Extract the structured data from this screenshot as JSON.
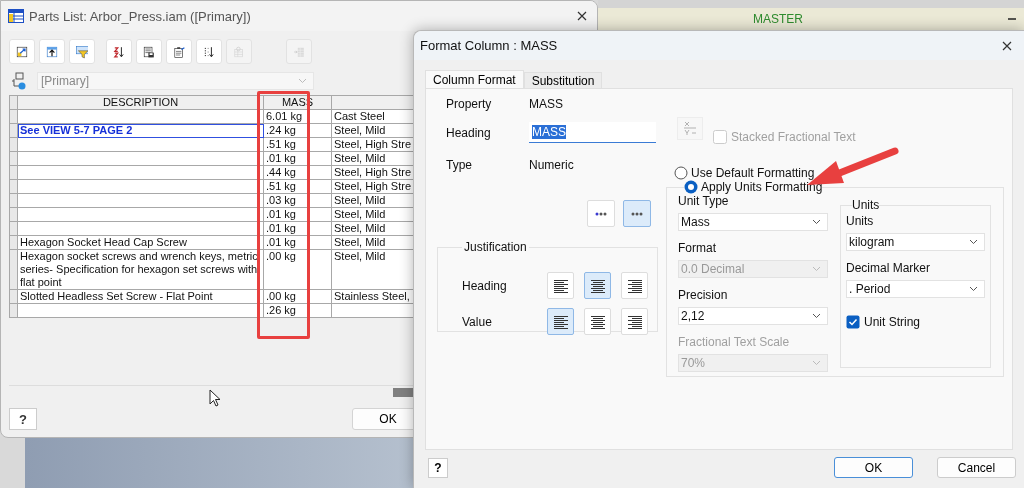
{
  "background_window": {
    "title": "MASTER"
  },
  "parts_list": {
    "title": "Parts List: Arbor_Press.iam ([Primary])",
    "toolbar_groups": [
      {
        "buttons": [
          {
            "disabled": false
          },
          {
            "disabled": false
          },
          {
            "disabled": false
          }
        ]
      },
      {
        "buttons": [
          {
            "disabled": false
          },
          {
            "disabled": false
          },
          {
            "disabled": false
          },
          {
            "disabled": false
          },
          {
            "disabled": true
          }
        ]
      },
      {
        "buttons": [
          {
            "disabled": true
          }
        ]
      }
    ],
    "view": {
      "value": "[Primary]",
      "disabled": true
    },
    "table": {
      "columns": [
        "DESCRIPTION",
        "MASS"
      ],
      "rows": [
        {
          "mass": "6.01 kg",
          "column_3": "Cast Steel",
          "selected": false
        },
        {
          "description": "See VIEW 5-7 PAGE 2",
          "mass": ".24 kg",
          "column_3": "Steel, Mild",
          "selected": true
        },
        {
          "mass": ".51 kg",
          "column_3": "Steel, High Stre",
          "selected": false
        },
        {
          "mass": ".01 kg",
          "column_3": "Steel, Mild",
          "selected": false
        },
        {
          "mass": ".44 kg",
          "column_3": "Steel, High Stre",
          "selected": false
        },
        {
          "mass": ".51 kg",
          "column_3": "Steel, High Stre",
          "selected": false
        },
        {
          "mass": ".03 kg",
          "column_3": "Steel, Mild",
          "selected": false
        },
        {
          "mass": ".01 kg",
          "column_3": "Steel, Mild",
          "selected": false
        },
        {
          "mass": ".01 kg",
          "column_3": "Steel, Mild",
          "selected": false
        },
        {
          "description": "Hexagon Socket Head Cap Screw",
          "mass": ".01 kg",
          "column_3": "Steel, Mild",
          "selected": false
        },
        {
          "description": "Hexagon socket screws and wrench keys, metric series- Specification for hexagon set screws with flat point",
          "mass": ".00 kg",
          "column_3": "Steel, Mild",
          "selected": false
        },
        {
          "description": "Slotted Headless Set Screw - Flat Point",
          "mass": ".00 kg",
          "column_3": "Stainless Steel,",
          "selected": false
        },
        {
          "mass": ".26 kg",
          "selected": false
        }
      ]
    },
    "help_button": "?",
    "ok_button": "OK"
  },
  "format_dialog": {
    "title": "Format Column : MASS",
    "tabs": [
      {
        "label": "Column Format",
        "selected": true
      },
      {
        "label": "Substitution",
        "selected": false
      }
    ],
    "fields": [
      {
        "kind": "text",
        "label": "Property",
        "value": "MASS"
      },
      {
        "kind": "input",
        "label": "Heading",
        "value": "MASS",
        "text_selected": true
      },
      {
        "kind": "text",
        "label": "Type",
        "value": "Numeric"
      }
    ],
    "position_buttons": [
      {
        "selected": false
      },
      {
        "selected": true
      }
    ],
    "justification": {
      "title": "Justification",
      "rows": [
        {
          "label": "Heading",
          "options": [
            {
              "selected": false
            },
            {
              "selected": true
            },
            {
              "selected": false
            }
          ]
        },
        {
          "label": "Value",
          "options": [
            {
              "selected": true
            },
            {
              "selected": false
            },
            {
              "selected": false
            }
          ]
        }
      ]
    },
    "fraction_button": {
      "disabled": true
    },
    "stacked_fractional_text": {
      "label": "Stacked Fractional Text",
      "checked": false,
      "disabled": true
    },
    "formatting_options": [
      {
        "label": "Use Default Formatting",
        "selected": false
      },
      {
        "label": "Apply Units Formatting",
        "selected": true
      }
    ],
    "unit_settings": [
      {
        "label": "Unit Type",
        "value": "Mass",
        "disabled": false,
        "label_disabled": false
      },
      {
        "label": "Format",
        "value": "0.0 Decimal",
        "disabled": true,
        "label_disabled": false
      },
      {
        "label": "Precision",
        "value": "2,12",
        "disabled": false,
        "label_disabled": false
      },
      {
        "label": "Fractional Text Scale",
        "value": "70%",
        "disabled": true,
        "label_disabled": true
      }
    ],
    "units_group": {
      "title": "Units",
      "settings": [
        {
          "label": "Units",
          "value": "kilogram",
          "disabled": false
        },
        {
          "label": "Decimal Marker",
          "value": ". Period",
          "disabled": false
        }
      ],
      "unit_string": {
        "label": "Unit String",
        "checked": true
      }
    },
    "help_button": "?",
    "buttons": [
      {
        "label": "OK",
        "default": true
      },
      {
        "label": "Cancel",
        "default": false
      }
    ]
  }
}
